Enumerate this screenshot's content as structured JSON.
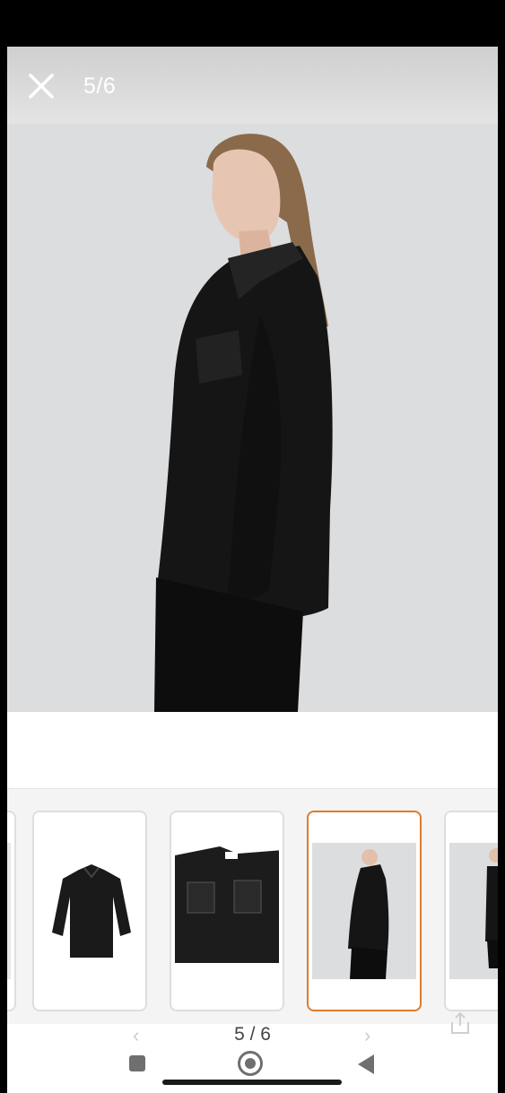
{
  "header": {
    "close_icon": "close-icon",
    "counter": "5/6"
  },
  "gallery": {
    "current_index": 5,
    "total": 6,
    "bottom_counter": "5 / 6"
  },
  "thumbnails": [
    {
      "index": 1,
      "active": false
    },
    {
      "index": 2,
      "active": false
    },
    {
      "index": 3,
      "active": false
    },
    {
      "index": 4,
      "active": false
    },
    {
      "index": 5,
      "active": true
    },
    {
      "index": 6,
      "active": false
    }
  ],
  "system_nav": {
    "recents_icon": "recents-icon",
    "home_icon": "home-icon",
    "back_icon": "back-icon"
  },
  "colors": {
    "active_border": "#e07b2a",
    "header_bg": "#d8d8d8",
    "photo_bg": "#dcdddf"
  }
}
